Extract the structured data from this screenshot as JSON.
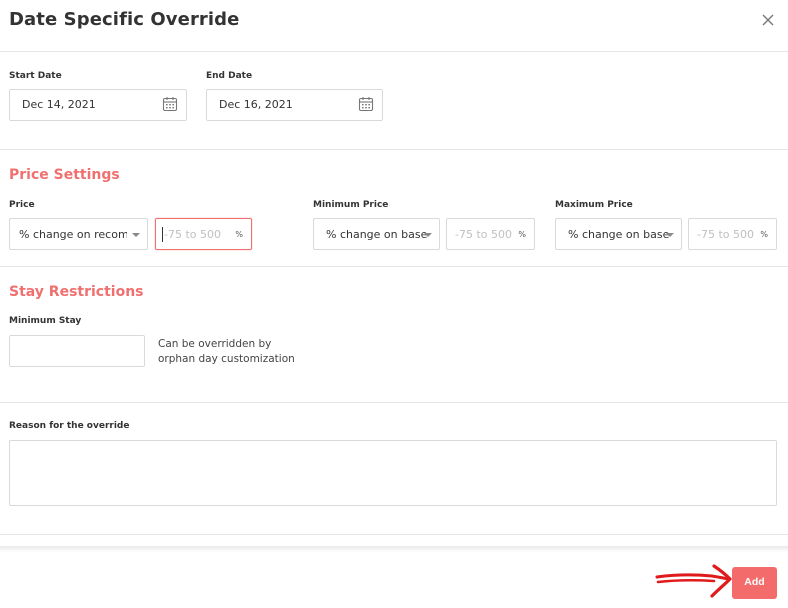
{
  "modal": {
    "title": "Date Specific Override",
    "close_icon": "close-icon"
  },
  "dates": {
    "start_label": "Start Date",
    "start_value": "Dec 14, 2021",
    "end_label": "End Date",
    "end_value": "Dec 16, 2021",
    "calendar_icon": "calendar-icon"
  },
  "price_settings": {
    "title": "Price Settings",
    "price": {
      "label": "Price",
      "mode": "% change on recommended",
      "placeholder": "-75 to 500",
      "unit": "%"
    },
    "minimum_price": {
      "label": "Minimum Price",
      "mode": "% change on base",
      "placeholder": "-75 to 500",
      "unit": "%"
    },
    "maximum_price": {
      "label": "Maximum Price",
      "mode": "% change on base",
      "placeholder": "-75 to 500",
      "unit": "%"
    }
  },
  "stay_restrictions": {
    "title": "Stay Restrictions",
    "minimum_stay_label": "Minimum Stay",
    "minimum_stay_value": "",
    "help_line1": "Can be overridden by",
    "help_line2": "orphan day customization"
  },
  "reason": {
    "label": "Reason for the override",
    "value": ""
  },
  "footer": {
    "add_label": "Add"
  },
  "colors": {
    "accent": "#f07070",
    "button": "#f46b6b",
    "annotation_arrow": "#e01b1b"
  }
}
